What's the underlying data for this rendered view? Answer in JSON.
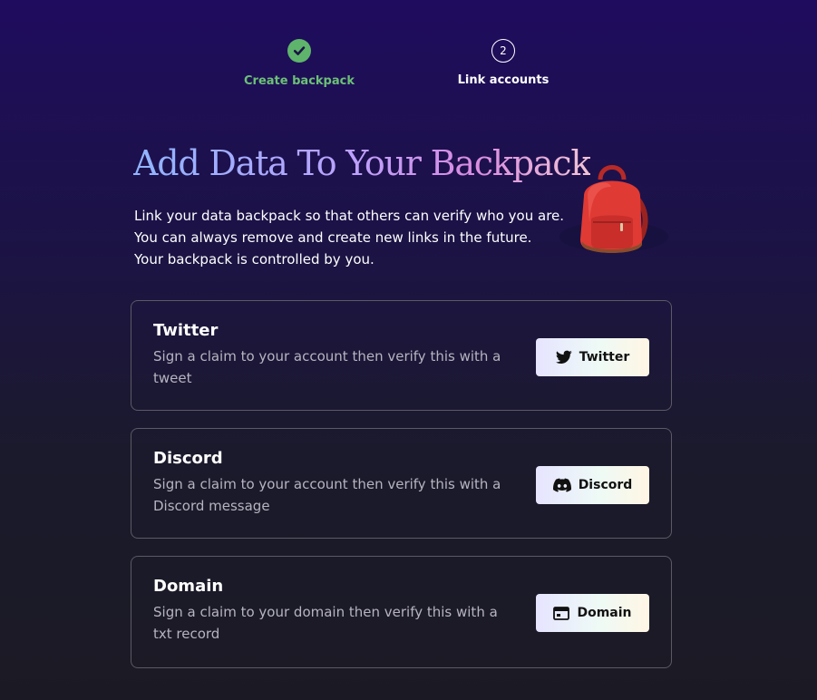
{
  "stepper": {
    "steps": [
      {
        "label": "Create backpack",
        "status": "done"
      },
      {
        "label": "Link accounts",
        "number": "2",
        "status": "current"
      }
    ]
  },
  "header": {
    "title": "Add Data To Your Backpack",
    "intro_lines": [
      "Link your data backpack so that others can verify who you are.",
      "You can always remove and create new links in the future.",
      "Your backpack is controlled by you."
    ]
  },
  "accounts": [
    {
      "title": "Twitter",
      "description": "Sign a claim to your account then verify this with a tweet",
      "button_label": "Twitter",
      "icon": "twitter-icon"
    },
    {
      "title": "Discord",
      "description": "Sign a claim to your account then verify this with a Discord message",
      "button_label": "Discord",
      "icon": "discord-icon"
    },
    {
      "title": "Domain",
      "description": "Sign a claim to your domain then verify this with a txt record",
      "button_label": "Domain",
      "icon": "domain-icon"
    }
  ],
  "colors": {
    "step_done": "#5fb46c",
    "card_border": "#5b5a63",
    "description_text": "#b6b4c0",
    "backpack_red": "#e33b35"
  }
}
